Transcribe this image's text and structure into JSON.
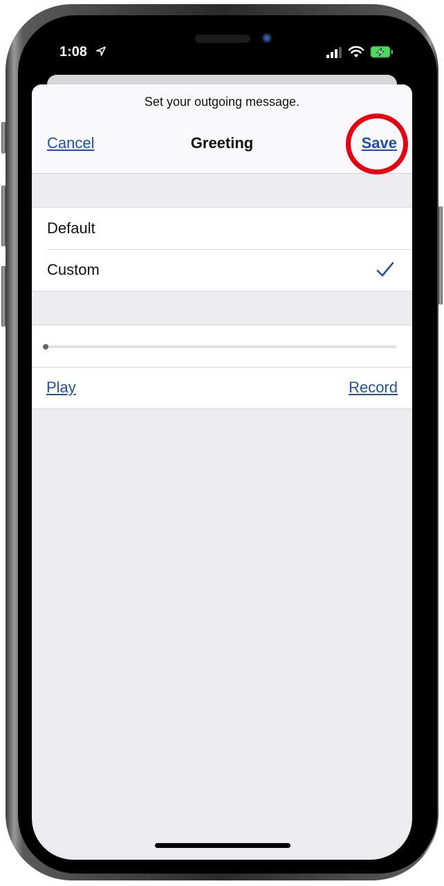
{
  "status_bar": {
    "time": "1:08",
    "icons": [
      "location-arrow-icon",
      "cellular-signal-icon",
      "wifi-icon",
      "battery-charging-icon"
    ],
    "battery_color": "#4cd964"
  },
  "sheet": {
    "prompt": "Set your outgoing message.",
    "nav": {
      "cancel_label": "Cancel",
      "title": "Greeting",
      "save_label": "Save"
    },
    "greeting_options": [
      {
        "label": "Default",
        "selected": false
      },
      {
        "label": "Custom",
        "selected": true
      }
    ],
    "playback": {
      "progress": 0,
      "play_label": "Play",
      "record_label": "Record"
    }
  },
  "colors": {
    "link": "#1f4fa8",
    "highlight_ring": "#e8000e"
  }
}
